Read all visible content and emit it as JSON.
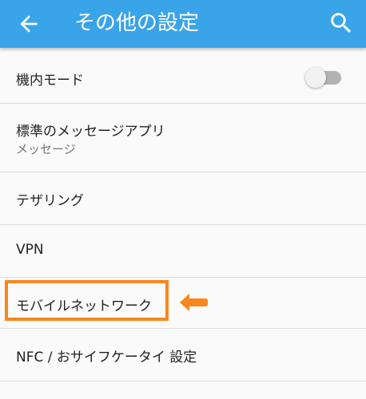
{
  "appbar": {
    "title": "その他の設定",
    "back_icon": "arrow-left-icon",
    "search_icon": "search-icon",
    "color": "#3aa4e8"
  },
  "settings": {
    "airplane_mode": {
      "label": "機内モード",
      "toggle_on": false
    },
    "default_sms_app": {
      "label": "標準のメッセージアプリ",
      "value": "メッセージ"
    },
    "tethering": {
      "label": "テザリング"
    },
    "vpn": {
      "label": "VPN"
    },
    "mobile_network": {
      "label": "モバイルネットワーク",
      "highlighted": true
    },
    "nfc": {
      "label": "NFC / おサイフケータイ 設定"
    }
  },
  "annotation": {
    "highlight_color": "#f7871e",
    "pointer_icon": "arrow-left-pointer-icon"
  }
}
